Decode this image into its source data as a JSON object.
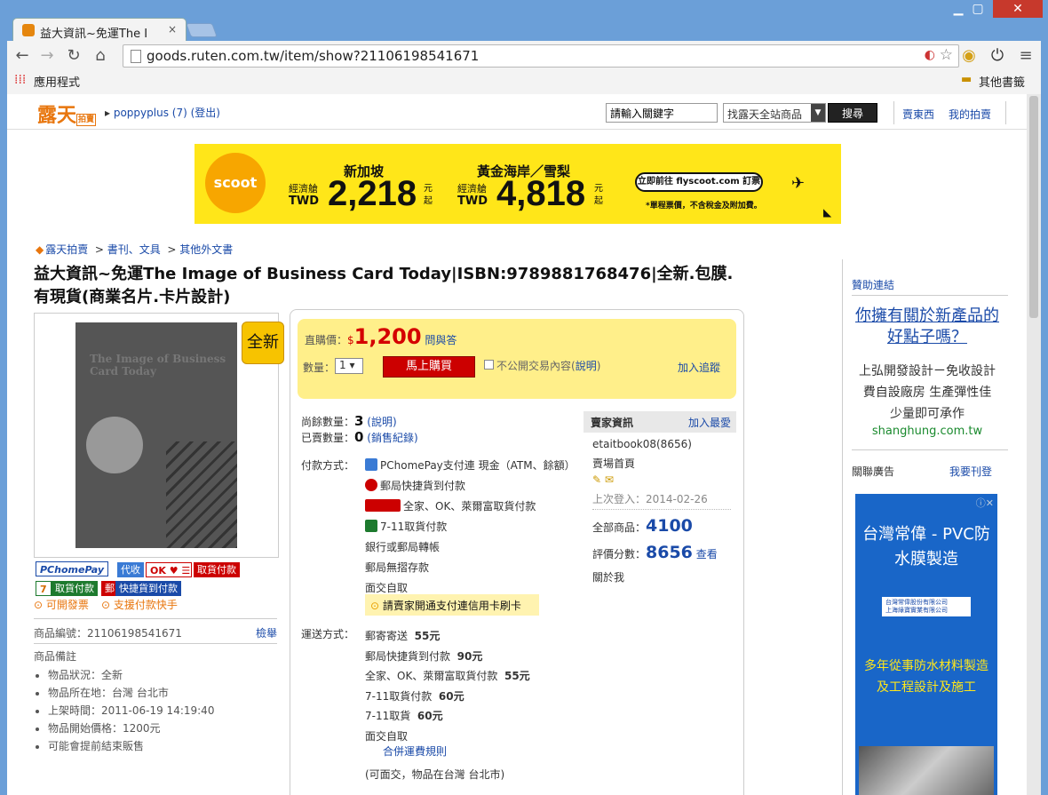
{
  "browser": {
    "tab_title": "益大資訊~免運The I",
    "tab_close": "×",
    "url": "goods.ruten.com.tw/item/show?21106198541671",
    "bookmark_apps": "應用程式",
    "bookmark_other": "其他書籤"
  },
  "topbar": {
    "logo": "露天",
    "logo_small": "拍賣",
    "user": "poppyplus (7)",
    "logout": "(登出)",
    "search_placeholder": "請輸入關鍵字",
    "search_scope": "找露天全站商品",
    "search_button": "搜尋",
    "sell_link": "賣東西",
    "my_auction_link": "我的拍賣"
  },
  "banner": {
    "brand": "scoot",
    "city1": "新加坡",
    "class": "經濟艙",
    "currency": "TWD",
    "price1": "2,218",
    "unit": "元起",
    "city2": "黃金海岸／雪梨",
    "price2": "4,818",
    "cta": "立即前往 flyscoot.com 訂票",
    "note": "*單程票價，不含稅金及附加費。"
  },
  "breadcrumb": [
    "露天拍賣",
    "書刊、文具",
    "其他外文書"
  ],
  "product": {
    "title": "益大資訊~免運The Image of Business Card Today|ISBN:9789881768476|全新.包膜.有現貨(商業名片.卡片設計)",
    "condition_tag": "全新",
    "cover_text": "The Image of Business Card Today",
    "id_label": "商品編號：21106198541671",
    "report": "檢舉",
    "notes_title": "商品備註",
    "notes": [
      "物品狀況：全新",
      "物品所在地：台灣 台北市",
      "上架時間：2011-06-19 14:19:40",
      "物品開始價格：1200元",
      "可能會提前結束販售"
    ],
    "invoice_link": "可開發票",
    "paytool_link": "支援付款快手",
    "pay_icons": [
      "PChomePay",
      "代收",
      "取貨付款",
      "取貨付款",
      "快捷貨到付款"
    ]
  },
  "buy": {
    "price_label": "直購價：",
    "currency": "$",
    "price": "1,200",
    "qa_link": "問與答",
    "qty_label": "數量：",
    "qty_value": "1 ▾",
    "buy_button": "馬上購買",
    "private_label": "不公開交易內容(",
    "private_link": "說明",
    "private_close": ")",
    "track_link": "加入追蹤",
    "remain_label": "尚餘數量：",
    "remain_value": "3",
    "remain_link": "(說明)",
    "sold_label": "已賣數量：",
    "sold_value": "0",
    "sold_link": "(銷售紀錄)",
    "payment_label": "付款方式：",
    "payments": [
      "PChomePay支付連 現金（ATM、餘額）",
      "郵局快捷貨到付款",
      "全家、OK、萊爾富取貨付款",
      "7-11取貨付款",
      "銀行或郵局轉帳",
      "郵局無摺存款",
      "面交自取"
    ],
    "credit_tip": "請賣家開通支付連信用卡刷卡",
    "shipping_label": "運送方式：",
    "shipping": [
      {
        "name": "郵寄寄送",
        "price": "55元"
      },
      {
        "name": "郵局快捷貨到付款",
        "price": "90元"
      },
      {
        "name": "全家、OK、萊爾富取貨付款",
        "price": "55元"
      },
      {
        "name": "7-11取貨付款",
        "price": "60元"
      },
      {
        "name": "7-11取貨",
        "price": "60元"
      },
      {
        "name": "面交自取",
        "price": ""
      }
    ],
    "shipping_rule": "合併運費規則",
    "location_note": "(可面交，物品在台灣 台北市)"
  },
  "seller": {
    "header": "賣家資訊",
    "fav_link": "加入最愛",
    "name": "etaitbook08(8656)",
    "store_link": "賣場首頁",
    "last_login": "上次登入：2014-02-26",
    "total_label": "全部商品：",
    "total_value": "4100",
    "rating_label": "評價分數：",
    "rating_value": "8656",
    "rating_link": "查看",
    "about_link": "關於我"
  },
  "sidebar": {
    "sponsor_title": "贊助連結",
    "ad_headline": "你擁有關於新產品的好點子嗎？",
    "ad_body1": "上弘開發設計ㄧ免收設計",
    "ad_body2": "費自設廠房 生產彈性佳",
    "ad_body3": "少量即可承作",
    "ad_url": "shanghung.com.tw",
    "related_title": "關聯廣告",
    "post_link": "我要刊登",
    "ad2_title": "台灣常偉 - PVC防水膜製造",
    "ad2_company1": "台灣常偉股份有限公司",
    "ad2_company2": "上海綠寶實業有限公司",
    "ad2_body": "多年從事防水材料製造及工程設計及施工"
  }
}
